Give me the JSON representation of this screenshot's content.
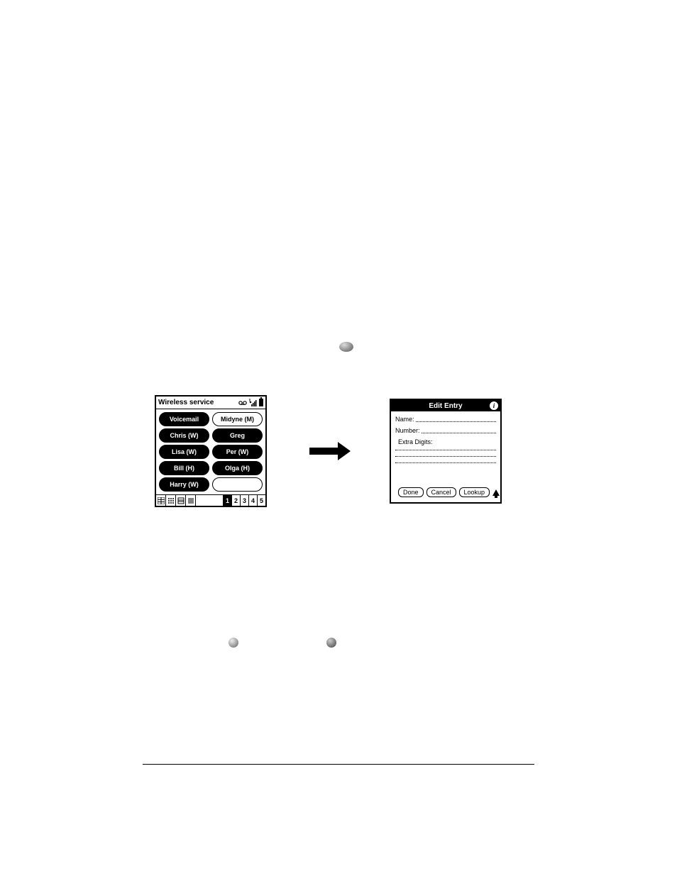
{
  "left_screen": {
    "title": "Wireless service",
    "buttons": [
      {
        "label": "Voicemail",
        "selected": false
      },
      {
        "label": "Midyne (M)",
        "selected": true
      },
      {
        "label": "Chris (W)",
        "selected": false
      },
      {
        "label": "Greg",
        "selected": false
      },
      {
        "label": "Lisa (W)",
        "selected": false
      },
      {
        "label": "Per (W)",
        "selected": false
      },
      {
        "label": "Bill (H)",
        "selected": false
      },
      {
        "label": "Olga (H)",
        "selected": false
      },
      {
        "label": "Harry (W)",
        "selected": false
      },
      {
        "label": "",
        "selected": false,
        "empty": true
      }
    ],
    "pages": [
      "1",
      "2",
      "3",
      "4",
      "5"
    ],
    "active_page": "1"
  },
  "right_screen": {
    "title": "Edit Entry",
    "fields": {
      "name_label": "Name:",
      "number_label": "Number:",
      "extra_label": "Extra Digits:"
    },
    "buttons": {
      "done": "Done",
      "cancel": "Cancel",
      "lookup": "Lookup"
    }
  }
}
